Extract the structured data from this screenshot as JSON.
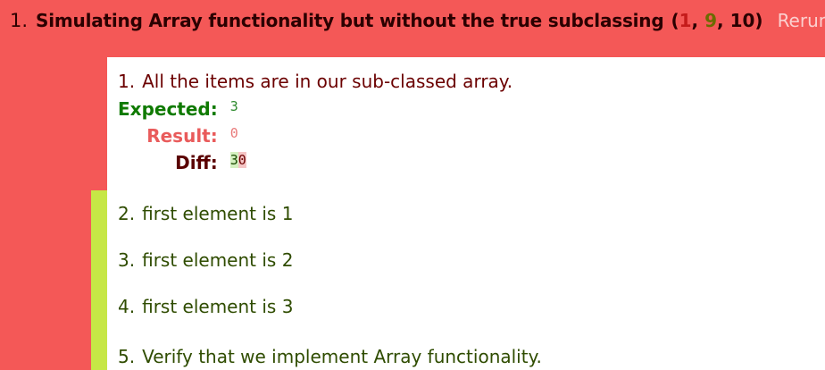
{
  "module": {
    "number": "1.",
    "name": "Simulating Array functionality but without the true subclassing",
    "counts": {
      "failed": "1",
      "passed": "9",
      "total": "10"
    },
    "rerun_label": "Rerun"
  },
  "assertions": [
    {
      "number": "1.",
      "message": "All the items are in our sub-classed array.",
      "status": "fail",
      "expected_label": "Expected:",
      "expected_value": "3",
      "result_label": "Result:",
      "result_value": "0",
      "diff_label": "Diff:",
      "diff_inserted": "3",
      "diff_deleted": "0"
    },
    {
      "number": "2.",
      "message": "first element is 1",
      "status": "pass"
    },
    {
      "number": "3.",
      "message": "first element is 2",
      "status": "pass"
    },
    {
      "number": "4.",
      "message": "first element is 3",
      "status": "pass"
    },
    {
      "number": "5.",
      "message": "Verify that we implement Array functionality.",
      "status": "pass"
    }
  ],
  "colors": {
    "fail": "#f45857",
    "pass": "#c6e746",
    "expected": "#0f7a00",
    "result": "#e95b5b"
  }
}
